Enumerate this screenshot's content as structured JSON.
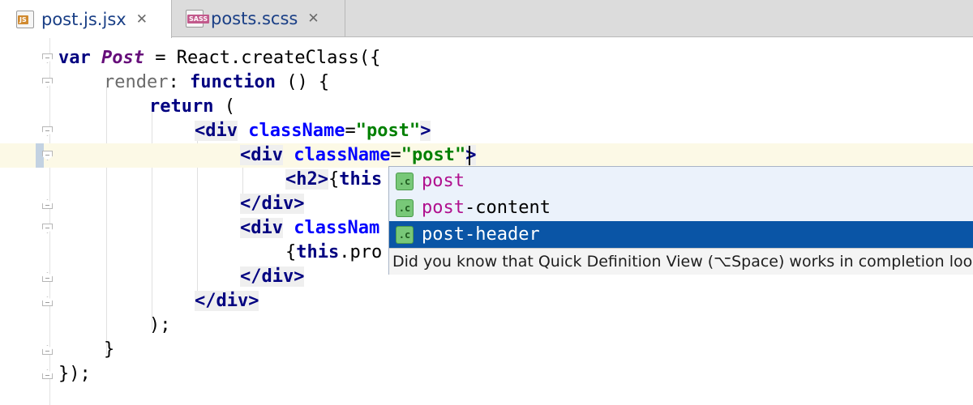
{
  "tabs": [
    {
      "label": "post.js.jsx",
      "icon": "js-file-icon",
      "badge": "JS",
      "active": true,
      "close": "✕"
    },
    {
      "label": "posts.scss",
      "icon": "sass-file-icon",
      "badge": "SASS",
      "active": false,
      "close": "✕"
    }
  ],
  "code": {
    "l1": {
      "kw": "var",
      "name": "Post",
      "rest": " = React.createClass({"
    },
    "l2": {
      "prop": "render",
      "colon": ": ",
      "kw": "function",
      "rest": " () {"
    },
    "l3": {
      "kw": "return",
      "rest": " ("
    },
    "l4": {
      "tag_open": "<div",
      "attr": "className",
      "eq": "=",
      "str": "\"post\"",
      "tag_close": ">"
    },
    "l5": {
      "tag_open": "<div",
      "attr": "className",
      "eq": "=",
      "str": "\"post",
      "str_end": "\"",
      "tag_close": ">"
    },
    "l6": {
      "tag": "<h2>",
      "brace": "{",
      "kw": "this"
    },
    "l7": {
      "tag": "</div>"
    },
    "l8": {
      "tag_open": "<div",
      "attr": "classNam"
    },
    "l9": {
      "brace": "{",
      "kw": "this",
      "rest": ".pro"
    },
    "l10": {
      "tag": "</div>"
    },
    "l11": {
      "tag": "</div>"
    },
    "l12": {
      "text": ");"
    },
    "l13": {
      "text": "}"
    },
    "l14": {
      "text": "});"
    }
  },
  "completion": {
    "items": [
      {
        "icon_glyph": ".c",
        "match": "post",
        "rest": ""
      },
      {
        "icon_glyph": ".c",
        "match": "post",
        "rest": "-content"
      },
      {
        "icon_glyph": ".c",
        "match": "post",
        "rest": "-header"
      }
    ],
    "selected_index": 2,
    "hint": "Did you know that Quick Definition View (⌥Space) works in completion lookups as well?"
  },
  "colors": {
    "keyword": "#000080",
    "class_name": "#660e7a",
    "string": "#008000",
    "attribute": "#0000ff",
    "selection": "#0a55a6",
    "match_highlight": "#b0108e"
  }
}
